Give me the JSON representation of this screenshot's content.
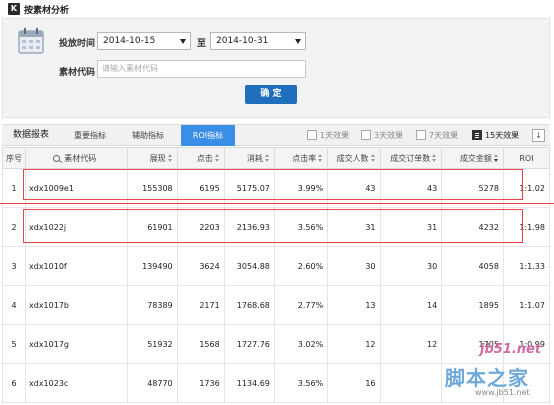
{
  "page": {
    "title": "按素材分析",
    "logo_letter": "K"
  },
  "filters": {
    "date_label": "投放时间",
    "start_date": "2014-10-15",
    "to_label": "至",
    "end_date": "2014-10-31",
    "code_label": "素材代码",
    "code_placeholder": "请输入素材代码",
    "confirm_label": "确 定"
  },
  "tabs": {
    "section_label": "数据报表",
    "items": [
      "重要指标",
      "辅助指标",
      "ROI指标"
    ],
    "active": "ROI指标"
  },
  "effects": {
    "items": [
      "1天效果",
      "3天效果",
      "7天效果",
      "15天效果"
    ],
    "selected": "15天效果"
  },
  "table": {
    "columns": [
      "序号",
      "素材代码",
      "展现",
      "点击",
      "消耗",
      "点击率",
      "成交人数",
      "成交订单数",
      "成交金额",
      "ROI"
    ],
    "rows": [
      [
        "1",
        "xdx1009e1",
        "155308",
        "6195",
        "5175.07",
        "3.99%",
        "43",
        "43",
        "5278",
        "1:1.02"
      ],
      [
        "2",
        "xdx1022j",
        "61901",
        "2203",
        "2136.93",
        "3.56%",
        "31",
        "31",
        "4232",
        "1:1.98"
      ],
      [
        "3",
        "xdx1010f",
        "139490",
        "3624",
        "3054.88",
        "2.60%",
        "30",
        "30",
        "4058",
        "1:1.33"
      ],
      [
        "4",
        "xdx1017b",
        "78389",
        "2171",
        "1768.68",
        "2.77%",
        "13",
        "14",
        "1895",
        "1:1.07"
      ],
      [
        "5",
        "xdx1017g",
        "51932",
        "1568",
        "1727.76",
        "3.02%",
        "12",
        "12",
        "1705",
        "1:0.99"
      ],
      [
        "6",
        "xdx1023c",
        "48770",
        "1736",
        "1134.69",
        "3.56%",
        "16",
        "",
        "",
        ""
      ]
    ]
  },
  "watermark": {
    "site": "jb51.net",
    "name": "脚本之家",
    "url": "www.jb51.net"
  },
  "colors": {
    "accent": "#3a8ee6",
    "button": "#1f6fbd",
    "highlight": "#e8424d"
  }
}
